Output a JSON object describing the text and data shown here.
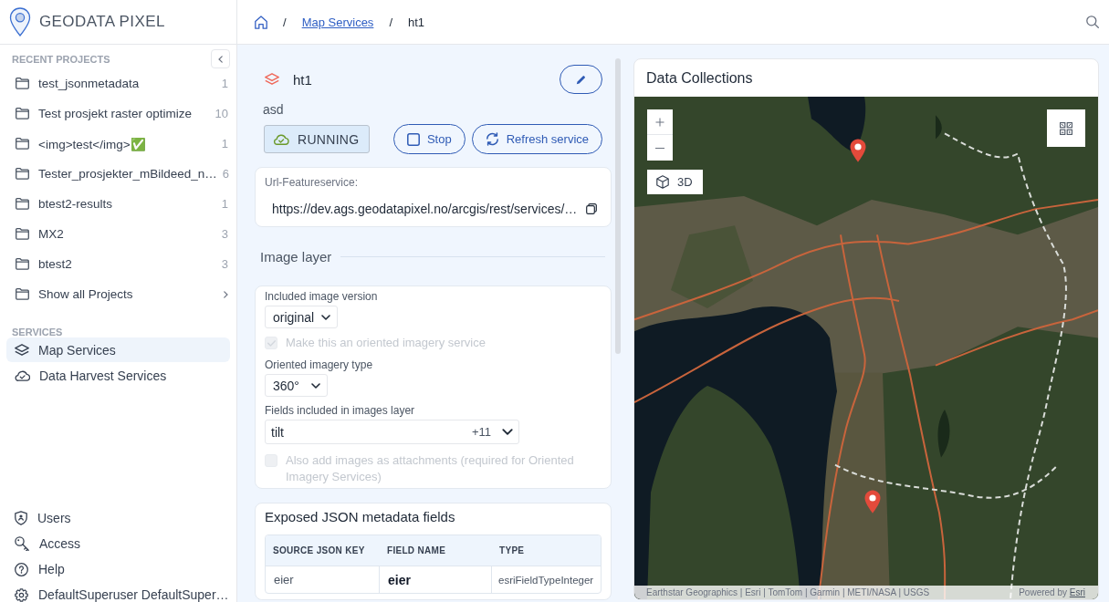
{
  "app": {
    "name": "GEODATA PIXEL"
  },
  "sidebar": {
    "recent_projects": {
      "heading": "RECENT PROJECTS",
      "items": [
        {
          "label": "test_jsonmetadata",
          "count": "1"
        },
        {
          "label": "Test prosjekt raster optimize",
          "count": "10"
        },
        {
          "label": "<img>test</img>✅",
          "count": "1"
        },
        {
          "label": "Tester_prosjekter_mBildeed_n…",
          "count": "6"
        },
        {
          "label": "btest2-results",
          "count": "1"
        },
        {
          "label": "MX2",
          "count": "3"
        },
        {
          "label": "btest2",
          "count": "3"
        }
      ],
      "show_all": "Show all Projects"
    },
    "services": {
      "heading": "SERVICES",
      "items": [
        {
          "label": "Map Services",
          "kind": "layers",
          "selected": true
        },
        {
          "label": "Data Harvest Services",
          "kind": "cloud",
          "selected": false
        }
      ]
    },
    "footer": [
      {
        "label": "Users",
        "kind": "users"
      },
      {
        "label": "Access",
        "kind": "access"
      },
      {
        "label": "Help",
        "kind": "help"
      },
      {
        "label": "DefaultSuperuser DefaultSuper…",
        "kind": "settings"
      }
    ]
  },
  "breadcrumb": [
    {
      "kind": "home"
    },
    {
      "kind": "separator",
      "label": "/"
    },
    {
      "kind": "link",
      "label": "Map Services"
    },
    {
      "kind": "separator",
      "label": "/"
    },
    {
      "kind": "current",
      "label": "ht1"
    }
  ],
  "service": {
    "name": "ht1",
    "description": "asd",
    "status": {
      "label": "RUNNING",
      "kind": "running"
    },
    "actions": [
      {
        "label": "Stop",
        "kind": "stop"
      },
      {
        "label": "Refresh service",
        "kind": "refresh"
      }
    ],
    "url": {
      "label": "Url-Featureservice:",
      "value": "https://dev.ags.geodatapixel.no/arcgis/rest/services/…"
    }
  },
  "image_layer": {
    "heading": "Image layer",
    "fields": [
      {
        "kind": "select",
        "label": "Included image version",
        "value": "original"
      },
      {
        "kind": "checkbox",
        "label": "Make this an oriented imagery service",
        "checked": true,
        "disabled": true
      },
      {
        "kind": "select",
        "label": "Oriented imagery type",
        "value": "360°"
      },
      {
        "kind": "multiselect",
        "label": "Fields included in images layer",
        "value": "tilt",
        "extra": "+11"
      },
      {
        "kind": "checkbox",
        "label": "Also add images as attachments (required for Oriented Imagery Services)",
        "checked": false,
        "disabled": true
      }
    ]
  },
  "metadata_fields": {
    "title": "Exposed JSON metadata fields",
    "columns": [
      "SOURCE JSON KEY",
      "FIELD NAME",
      "TYPE"
    ],
    "rows": [
      {
        "source_key": "eier",
        "field_name": "eier",
        "type": "esriFieldTypeInteger"
      }
    ]
  },
  "map_panel": {
    "title": "Data Collections",
    "view_toggle": "3D",
    "attribution": "Earthstar Geographics | Esri | TomTom | Garmin | METI/NASA | USGS",
    "powered_by": "Powered by",
    "powered_by_link": "Esri"
  }
}
